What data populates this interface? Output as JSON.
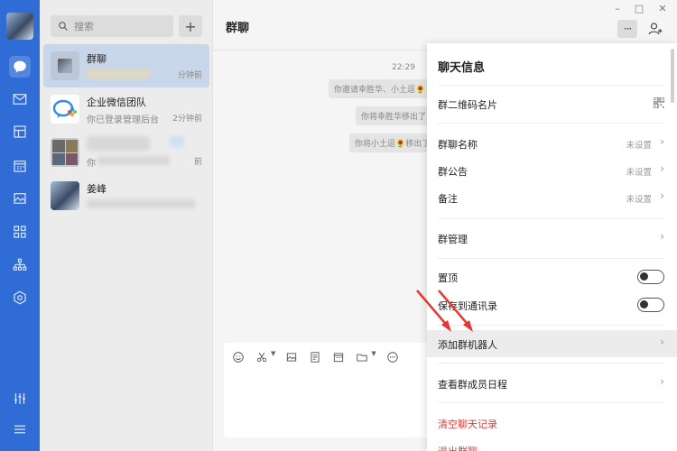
{
  "search": {
    "placeholder": "搜索"
  },
  "add_button": "+",
  "conversations": [
    {
      "name": "群聊",
      "preview": "",
      "time": "分钟前"
    },
    {
      "name": "企业微信团队",
      "preview": "你已登录管理后台",
      "time": "2分钟前"
    },
    {
      "name": "",
      "preview": "你",
      "time": "前"
    },
    {
      "name": "姜峰",
      "preview": "",
      "time": ""
    }
  ],
  "chat": {
    "title": "群聊",
    "timestamp": "22:29",
    "system_messages": [
      "你邀请幸胜华、小土逗🌻",
      "你将幸胜华移出了",
      "你将小土逗🌻移出了"
    ]
  },
  "window": {
    "minimize": "–",
    "maximize": "□",
    "close": "✕",
    "more": "···"
  },
  "panel": {
    "title": "聊天信息",
    "rows": {
      "qr": "群二维码名片",
      "name": "群聊名称",
      "notice": "群公告",
      "remark": "备注",
      "manage": "群管理",
      "pin": "置顶",
      "save_contacts": "保存到通讯录",
      "add_robot": "添加群机器人",
      "schedule": "查看群成员日程",
      "clear": "清空聊天记录",
      "quit": "退出群聊"
    },
    "unset": "未设置",
    "chevron": "›",
    "pin_on": false,
    "save_contacts_on": false
  },
  "icons": {
    "rail": [
      "message-icon",
      "mail-icon",
      "docs-icon",
      "calendar-icon",
      "photo-icon",
      "apps-icon",
      "org-chart-icon",
      "cube-icon",
      "settings-sliders-icon",
      "menu-icon"
    ]
  },
  "colors": {
    "rail": "#2f6cd6",
    "selected_conv": "#c8d6ea",
    "danger": "#e53935",
    "arrow": "#e53935"
  }
}
